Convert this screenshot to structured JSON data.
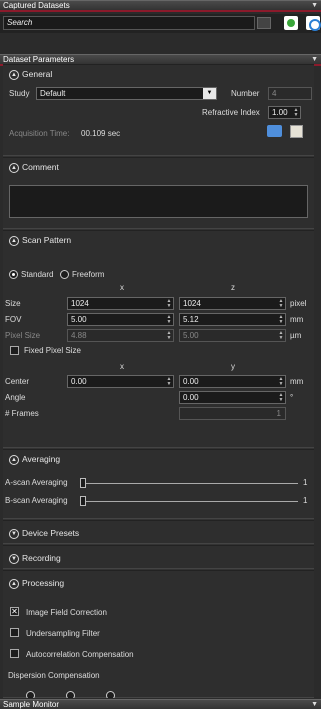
{
  "captured": {
    "title": "Captured Datasets",
    "search_placeholder": "Search"
  },
  "params": {
    "title": "Dataset Parameters"
  },
  "general": {
    "title": "General",
    "study_label": "Study",
    "study_value": "Default",
    "number_label": "Number",
    "number_value": "4",
    "ri_label": "Refractive Index",
    "ri_value": "1.00",
    "acq_label": "Acquisition Time:",
    "acq_value": "00.109 sec"
  },
  "comment": {
    "title": "Comment",
    "text": ""
  },
  "scan": {
    "title": "Scan Pattern",
    "mode_standard": "Standard",
    "mode_freeform": "Freeform",
    "col_x": "x",
    "col_z": "z",
    "size_label": "Size",
    "size_x": "1024",
    "size_z": "1024",
    "size_unit": "pixel",
    "fov_label": "FOV",
    "fov_x": "5.00",
    "fov_z": "5.12",
    "fov_unit": "mm",
    "pixel_label": "Pixel Size",
    "pixel_x": "4.88",
    "pixel_z": "5.00",
    "pixel_unit": "µm",
    "fixed_label": "Fixed Pixel Size",
    "col_x2": "x",
    "col_y": "y",
    "center_label": "Center",
    "center_x": "0.00",
    "center_y": "0.00",
    "center_unit": "mm",
    "angle_label": "Angle",
    "angle_value": "0.00",
    "angle_unit": "°",
    "frames_label": "# Frames",
    "frames_value": "1"
  },
  "averaging": {
    "title": "Averaging",
    "ascan_label": "A-scan Averaging",
    "ascan_value": "1",
    "ascan_level": 0,
    "bscan_label": "B-scan Averaging",
    "bscan_value": "1",
    "bscan_level": 0
  },
  "device": {
    "title": "Device Presets"
  },
  "recording": {
    "title": "Recording"
  },
  "processing": {
    "title": "Processing",
    "ifc_label": "Image Field Correction",
    "ifc_checked": true,
    "usf_label": "Undersampling Filter",
    "acc_label": "Autocorrelation Compensation",
    "disp_label": "Dispersion Compensation"
  },
  "monitor": {
    "title": "Sample Monitor"
  },
  "colors": {
    "accent": "#8b1a2b",
    "panel": "#333333",
    "field": "#1b1b1b"
  },
  "icons": {
    "expand": "chevron-up-circle-icon",
    "collapse": "chevron-down-circle-icon"
  }
}
